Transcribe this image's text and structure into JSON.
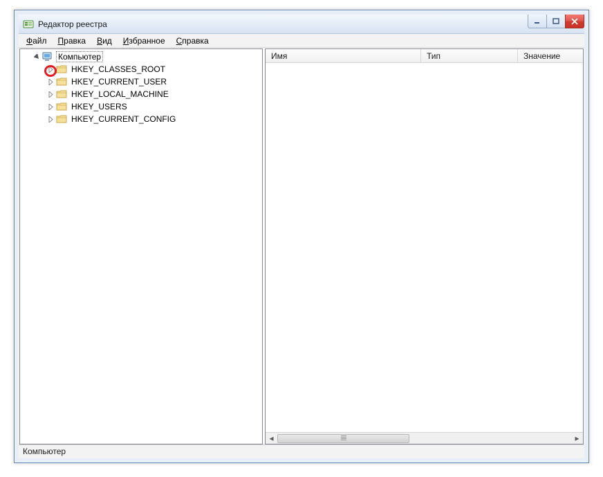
{
  "window": {
    "title": "Редактор реестра"
  },
  "menu": {
    "file": {
      "pre": "",
      "ul": "Ф",
      "post": "айл"
    },
    "edit": {
      "pre": "",
      "ul": "П",
      "post": "равка"
    },
    "view": {
      "pre": "",
      "ul": "В",
      "post": "ид"
    },
    "favorites": {
      "pre": "",
      "ul": "И",
      "post": "збранное"
    },
    "help": {
      "pre": "",
      "ul": "С",
      "post": "правка"
    }
  },
  "tree": {
    "root": {
      "label": "Компьютер"
    },
    "items": [
      {
        "label": "HKEY_CLASSES_ROOT"
      },
      {
        "label": "HKEY_CURRENT_USER"
      },
      {
        "label": "HKEY_LOCAL_MACHINE"
      },
      {
        "label": "HKEY_USERS"
      },
      {
        "label": "HKEY_CURRENT_CONFIG"
      }
    ]
  },
  "columns": {
    "name": "Имя",
    "type": "Тип",
    "value": "Значение"
  },
  "statusbar": {
    "path": "Компьютер"
  }
}
